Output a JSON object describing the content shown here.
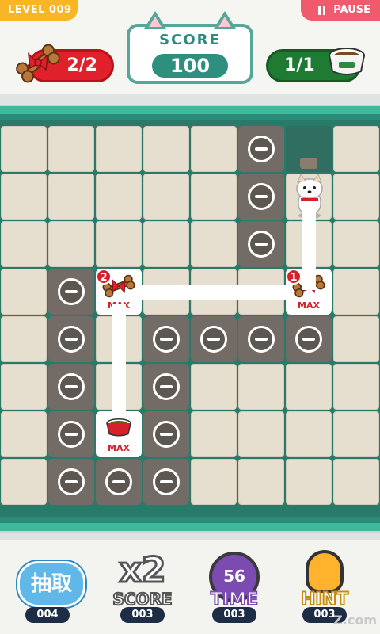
{
  "header": {
    "level_label": "LEVEL 009",
    "pause_label": "PAUSE",
    "score_title": "SCORE",
    "score_value": "100",
    "bones_count": "2/2",
    "bowls_count": "1/1"
  },
  "board": {
    "rows": 8,
    "cols": 8,
    "grid": [
      [
        "empty",
        "empty",
        "empty",
        "empty",
        "empty",
        "block",
        "dark",
        "empty"
      ],
      [
        "empty",
        "empty",
        "empty",
        "empty",
        "empty",
        "block",
        "dog",
        "empty"
      ],
      [
        "empty",
        "empty",
        "empty",
        "empty",
        "empty",
        "block",
        "path",
        "empty"
      ],
      [
        "empty",
        "block",
        "bone2",
        "path",
        "path",
        "path",
        "bone1",
        "empty"
      ],
      [
        "empty",
        "block",
        "path",
        "block",
        "block",
        "block",
        "block",
        "empty"
      ],
      [
        "empty",
        "block",
        "path",
        "block",
        "empty",
        "empty",
        "empty",
        "empty"
      ],
      [
        "empty",
        "block",
        "bowl",
        "block",
        "empty",
        "empty",
        "empty",
        "empty"
      ],
      [
        "empty",
        "block",
        "block",
        "block",
        "empty",
        "empty",
        "empty",
        "empty"
      ]
    ],
    "max_label": "MAX",
    "bone1_number": "1",
    "bone2_number": "2"
  },
  "footer": {
    "grab_label": "抽取",
    "grab_count": "004",
    "x2_big": "x2",
    "x2_word": "SCORE",
    "x2_count": "003",
    "time_value": "56",
    "time_word": "TIME",
    "time_count": "003",
    "hint_word": "HINT",
    "hint_count": "003",
    "watermark": "Z.com"
  }
}
